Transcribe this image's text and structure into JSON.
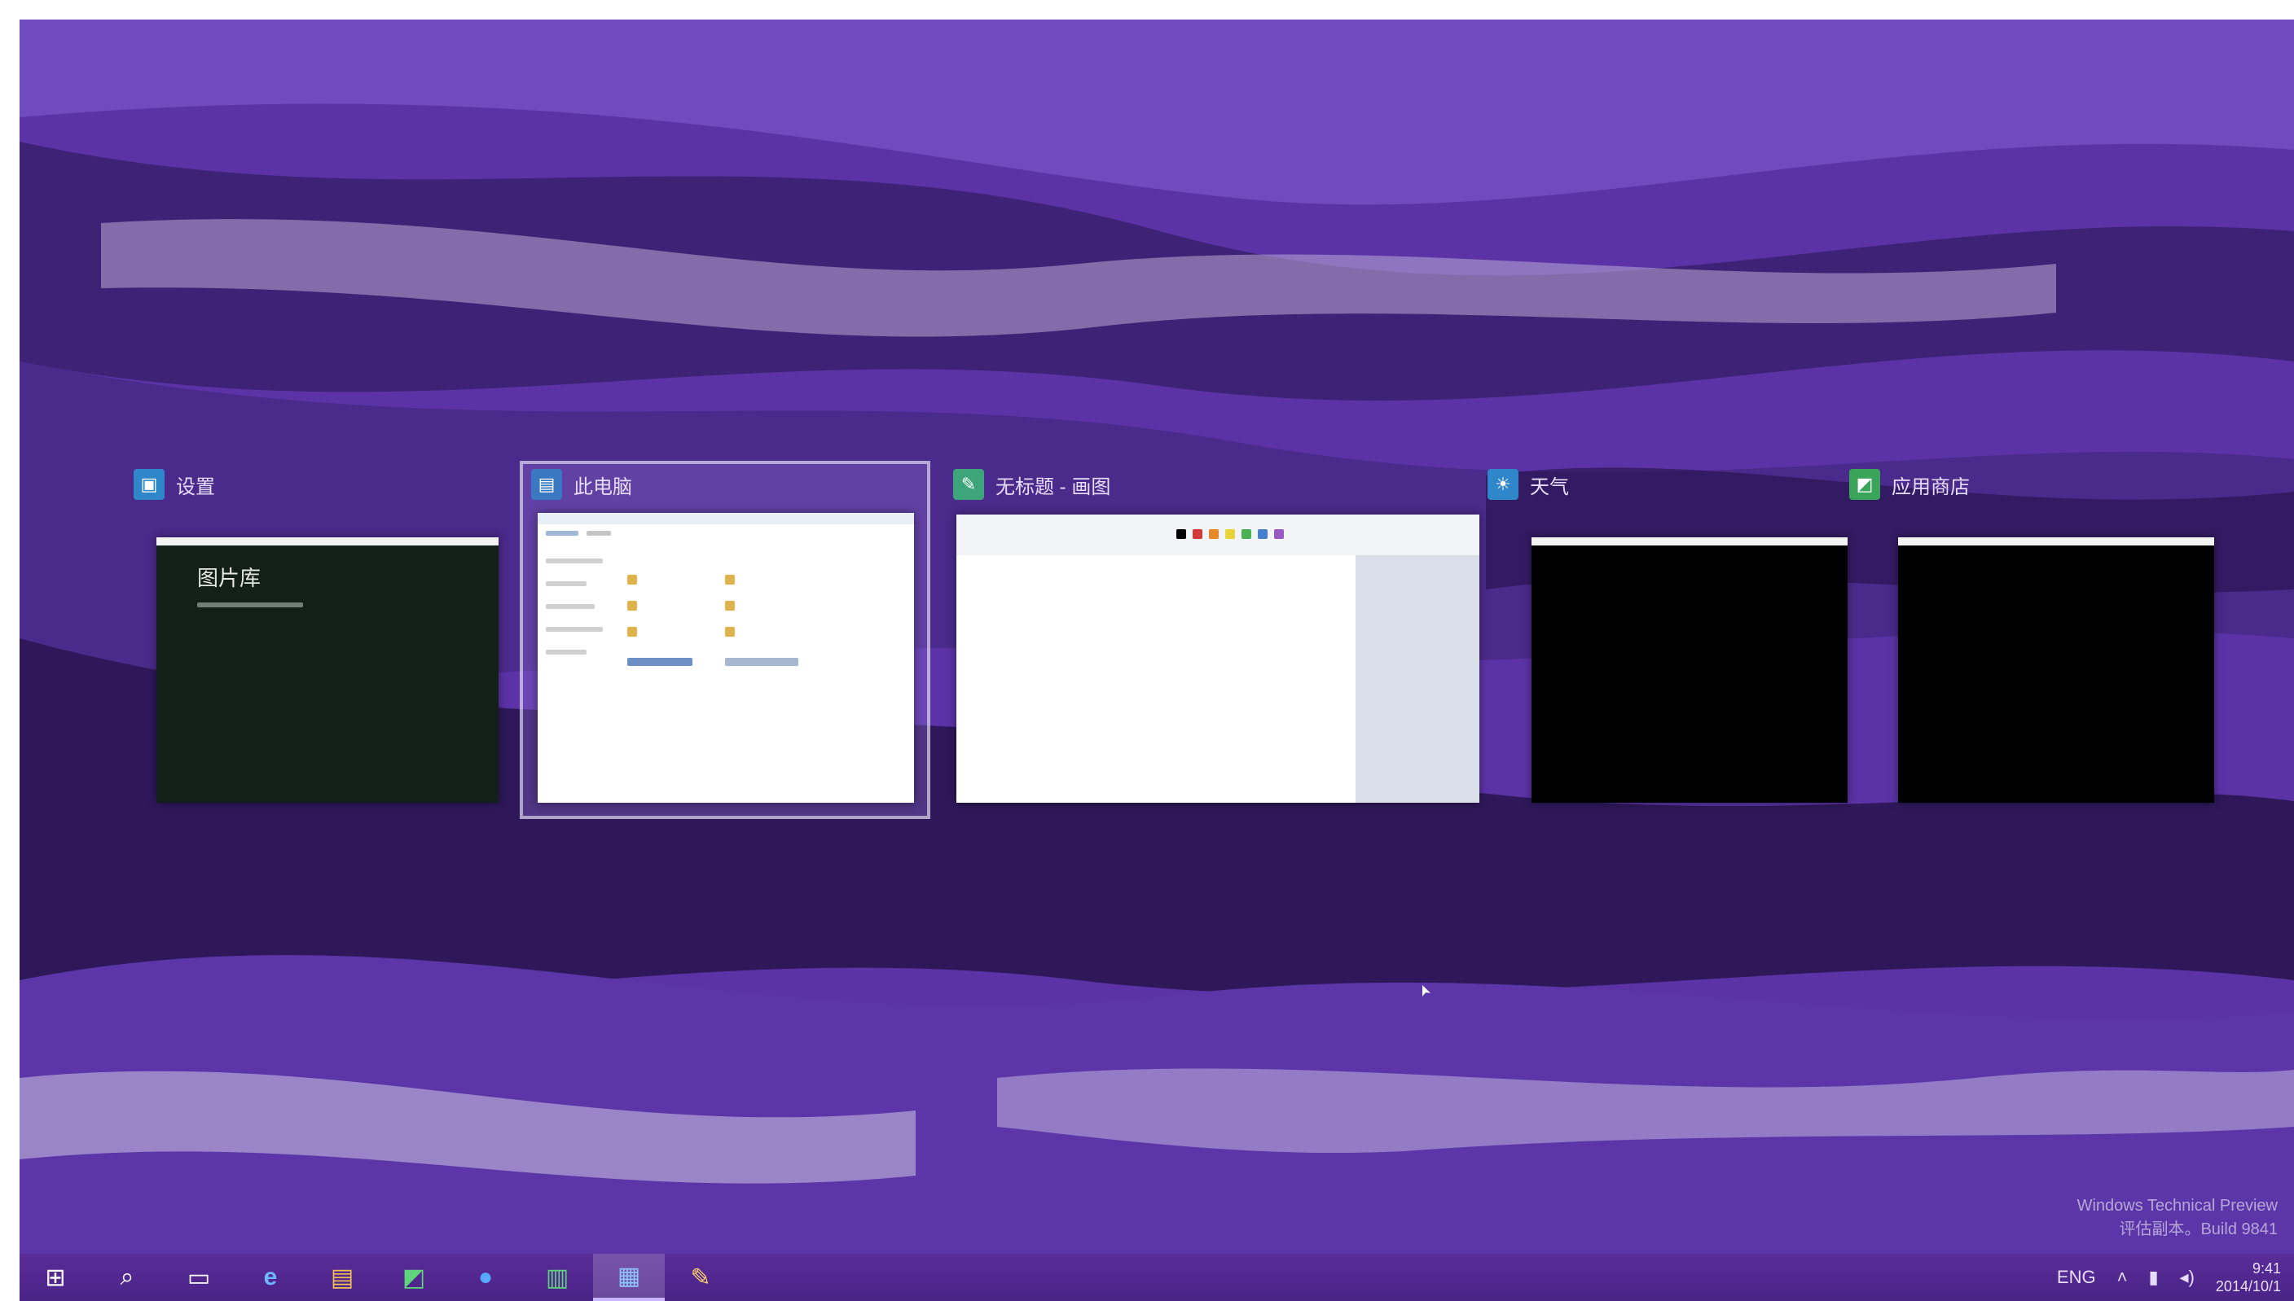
{
  "windows": [
    {
      "title": "设置",
      "icon": "settings-app-icon",
      "content_heading": "图片库"
    },
    {
      "title": "此电脑",
      "icon": "this-pc-icon"
    },
    {
      "title": "无标题 - 画图",
      "icon": "paint-icon"
    },
    {
      "title": "天气",
      "icon": "weather-icon"
    },
    {
      "title": "应用商店",
      "icon": "store-icon"
    }
  ],
  "taskbar": {
    "buttons": [
      {
        "name": "start-button",
        "glyph": "⊞"
      },
      {
        "name": "search-button",
        "glyph": "⌕"
      },
      {
        "name": "task-view-button",
        "glyph": "▭"
      },
      {
        "name": "ie-button",
        "glyph": "e"
      },
      {
        "name": "file-explorer-button",
        "glyph": "▤"
      },
      {
        "name": "store-button",
        "glyph": "◩"
      },
      {
        "name": "weather-button",
        "glyph": "●"
      },
      {
        "name": "app-button",
        "glyph": "▥"
      },
      {
        "name": "pc-button",
        "glyph": "▦"
      },
      {
        "name": "paint-button",
        "glyph": "✎"
      }
    ],
    "tray": {
      "keyboard": "ENG",
      "time": "9:41",
      "date": "2014/10/1"
    }
  },
  "watermark": {
    "line1": "Windows Technical Preview",
    "line2": "评估副本。Build 9841"
  },
  "colors": {
    "accent": "#5a2d99",
    "highlight": "#c9b5ff"
  }
}
